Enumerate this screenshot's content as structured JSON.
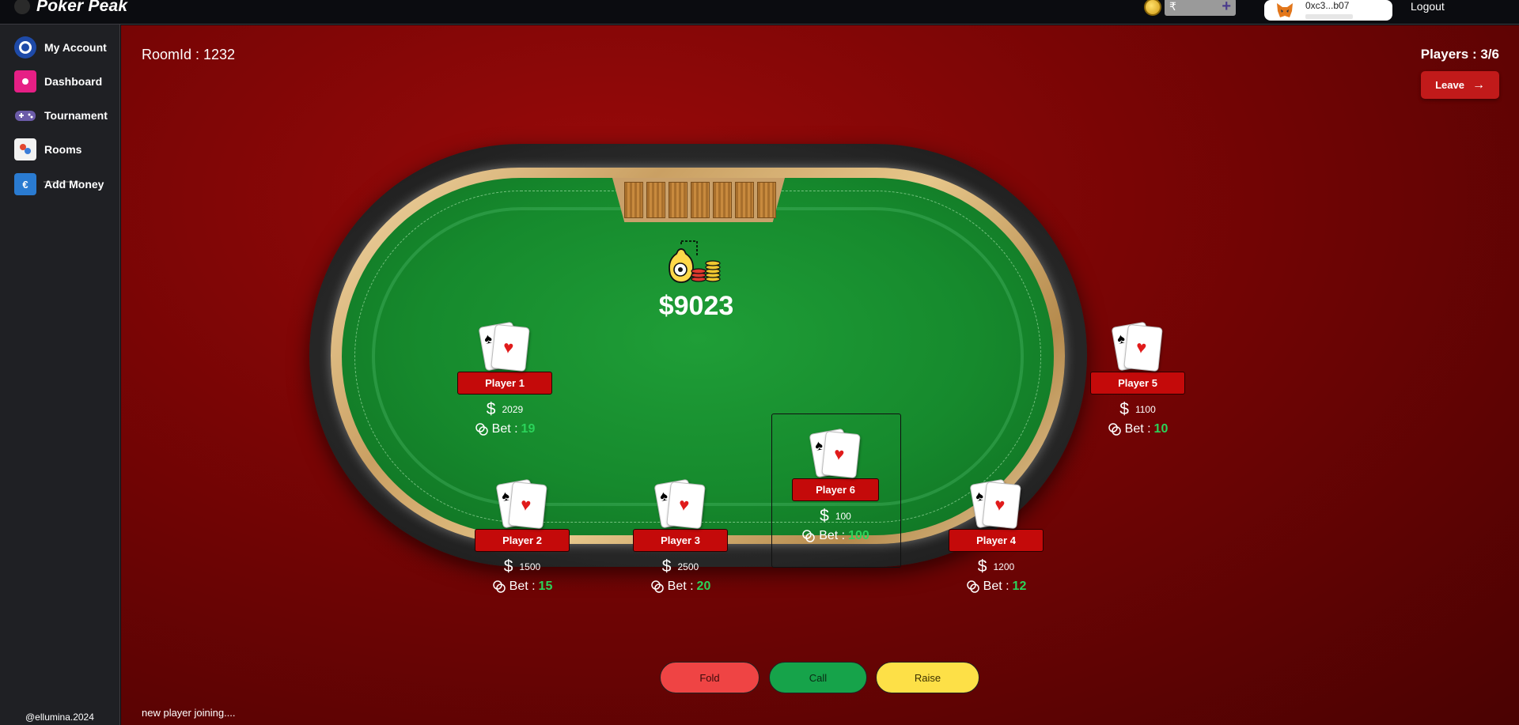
{
  "app": {
    "name": "Poker Peak"
  },
  "header": {
    "balance_symbol": "₹",
    "balance_value": "",
    "add_symbol": "+",
    "wallet_address": "0xc3...b07",
    "logout_label": "Logout"
  },
  "sidebar": {
    "items": [
      {
        "label": "My Account",
        "icon": "account-icon"
      },
      {
        "label": "Dashboard",
        "icon": "dashboard-icon"
      },
      {
        "label": "Tournament",
        "icon": "gamepad-icon"
      },
      {
        "label": "Rooms",
        "icon": "rooms-icon"
      },
      {
        "label": "Add Money",
        "icon": "wallet-icon"
      }
    ],
    "footer": "@ellumina.2024"
  },
  "room": {
    "room_id_text": "RoomId : 1232",
    "players_text": "Players : 3/6",
    "leave_label": "Leave",
    "leave_arrow": "→"
  },
  "table": {
    "pot": "$9023",
    "seats": [
      {
        "name": "Player 1",
        "chips": "2029",
        "bet_label": "Bet :",
        "bet": "19"
      },
      {
        "name": "Player 5",
        "chips": "1100",
        "bet_label": "Bet :",
        "bet": "10"
      },
      {
        "name": "Player 6",
        "chips": "100",
        "bet_label": "Bet :",
        "bet": "100"
      },
      {
        "name": "Player 2",
        "chips": "1500",
        "bet_label": "Bet :",
        "bet": "15"
      },
      {
        "name": "Player 3",
        "chips": "2500",
        "bet_label": "Bet :",
        "bet": "20"
      },
      {
        "name": "Player 4",
        "chips": "1200",
        "bet_label": "Bet :",
        "bet": "12"
      }
    ],
    "dollar_symbol": "$",
    "card_symbols": {
      "spade": "♠",
      "heart": "♥"
    }
  },
  "actions": {
    "fold": "Fold",
    "call": "Call",
    "raise": "Raise"
  },
  "status": "new player joining....",
  "colors": {
    "fold": "#ef4444",
    "call": "#16a34a",
    "raise": "#fde047",
    "seat_tag": "#c40a0a",
    "bet_value": "#2bd35a"
  }
}
